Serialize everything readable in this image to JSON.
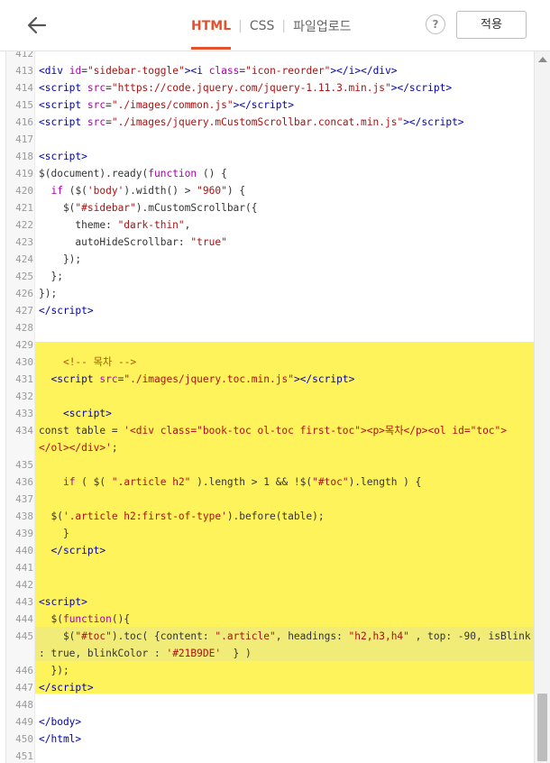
{
  "header": {
    "tabs": [
      "HTML",
      "CSS",
      "파일업로드"
    ],
    "active_tab": "HTML",
    "help_label": "?",
    "apply_label": "적용"
  },
  "editor": {
    "lines": [
      {
        "n": "412",
        "html": ""
      },
      {
        "n": "413",
        "html": "<span class=\"t\">&lt;div</span> <span class=\"a\">id</span>=<span class=\"s\">\"sidebar-toggle\"</span><span class=\"t\">&gt;&lt;i</span> <span class=\"a\">class</span>=<span class=\"s\">\"icon-reorder\"</span><span class=\"t\">&gt;&lt;/i&gt;&lt;/div&gt;</span>"
      },
      {
        "n": "414",
        "html": "<span class=\"t\">&lt;script</span> <span class=\"a\">src</span>=<span class=\"s\">\"https://code.jquery.com/jquery-1.11.3.min.js\"</span><span class=\"t\">&gt;&lt;/script&gt;</span>"
      },
      {
        "n": "415",
        "html": "<span class=\"t\">&lt;script</span> <span class=\"a\">src</span>=<span class=\"s\">\"./images/common.js\"</span><span class=\"t\">&gt;&lt;/script&gt;</span>"
      },
      {
        "n": "416",
        "html": "<span class=\"t\">&lt;script</span> <span class=\"a\">src</span>=<span class=\"s\">\"./images/jquery.mCustomScrollbar.concat.min.js\"</span><span class=\"t\">&gt;&lt;/script&gt;</span>"
      },
      {
        "n": "417",
        "html": ""
      },
      {
        "n": "418",
        "html": "<span class=\"t\">&lt;script&gt;</span>"
      },
      {
        "n": "419",
        "html": "$(document).ready(<span class=\"k\">function</span> () {"
      },
      {
        "n": "420",
        "html": "  <span class=\"k\">if</span> ($(<span class=\"s\">'body'</span>).width() &gt; <span class=\"s\">\"960\"</span>) {"
      },
      {
        "n": "421",
        "html": "    $(<span class=\"s\">\"#sidebar\"</span>).mCustomScrollbar({"
      },
      {
        "n": "422",
        "html": "      theme: <span class=\"s\">\"dark-thin\"</span>,"
      },
      {
        "n": "423",
        "html": "      autoHideScrollbar: <span class=\"s\">\"true\"</span>"
      },
      {
        "n": "424",
        "html": "    });"
      },
      {
        "n": "425",
        "html": "  };"
      },
      {
        "n": "426",
        "html": "});"
      },
      {
        "n": "427",
        "html": "<span class=\"t\">&lt;/script&gt;</span>"
      },
      {
        "n": "428",
        "html": ""
      },
      {
        "n": "429",
        "html": ""
      },
      {
        "n": "430",
        "html": "    <span class=\"c\">&lt;!-- 목차 --&gt;</span>"
      },
      {
        "n": "431",
        "html": "  <span class=\"t\">&lt;script</span> <span class=\"a\">src</span>=<span class=\"s\">\"./images/jquery.toc.min.js\"</span><span class=\"t\">&gt;&lt;/script&gt;</span>"
      },
      {
        "n": "432",
        "html": ""
      },
      {
        "n": "433",
        "html": "    <span class=\"t\">&lt;script&gt;</span>"
      },
      {
        "n": "434",
        "html": "const table = <span class=\"s\">'&lt;div class=\"book-toc ol-toc first-toc\"&gt;&lt;p&gt;목차&lt;/p&gt;&lt;ol id=\"toc\"&gt;</span>"
      },
      {
        "n": "",
        "html": "<span class=\"s\">&lt;/ol&gt;&lt;/div&gt;'</span>;"
      },
      {
        "n": "435",
        "html": ""
      },
      {
        "n": "436",
        "html": "    <span class=\"k\">if</span> ( $( <span class=\"s\">\".article h2\"</span> ).length &gt; 1 &amp;&amp; !$(<span class=\"s\">\"#toc\"</span>).length ) {"
      },
      {
        "n": "437",
        "html": ""
      },
      {
        "n": "438",
        "html": "  $(<span class=\"s\">'.article h2:first-of-type'</span>).before(table);"
      },
      {
        "n": "439",
        "html": "    }"
      },
      {
        "n": "440",
        "html": "  <span class=\"t\">&lt;/script&gt;</span>"
      },
      {
        "n": "441",
        "html": ""
      },
      {
        "n": "442",
        "html": ""
      },
      {
        "n": "443",
        "html": "<span class=\"t\">&lt;script&gt;</span>"
      },
      {
        "n": "444",
        "html": "  $(<span class=\"k\">function</span>(){"
      },
      {
        "n": "445",
        "html": "    $(<span class=\"s\">\"#toc\"</span>).toc( {content: <span class=\"s\">\".article\"</span>, headings: <span class=\"s\">\"h2,h3,h4\"</span> , top: -90, isBlink"
      },
      {
        "n": "",
        "html": ": true, blinkColor : <span class=\"s\">'#21B9DE'</span>  } )"
      },
      {
        "n": "446",
        "html": "  });"
      },
      {
        "n": "447",
        "html": "<span class=\"t\">&lt;/script&gt;</span>"
      },
      {
        "n": "448",
        "html": ""
      },
      {
        "n": "449",
        "html": "<span class=\"t\">&lt;/body&gt;</span>"
      },
      {
        "n": "450",
        "html": "<span class=\"t\">&lt;/html&gt;</span>"
      },
      {
        "n": "451",
        "html": ""
      }
    ]
  },
  "colors": {
    "accent": "#e2532d",
    "highlight": "#fff35c",
    "tag": "#0000aa",
    "attribute": "#aa00aa",
    "string": "#aa1111",
    "comment": "#aa5500"
  }
}
